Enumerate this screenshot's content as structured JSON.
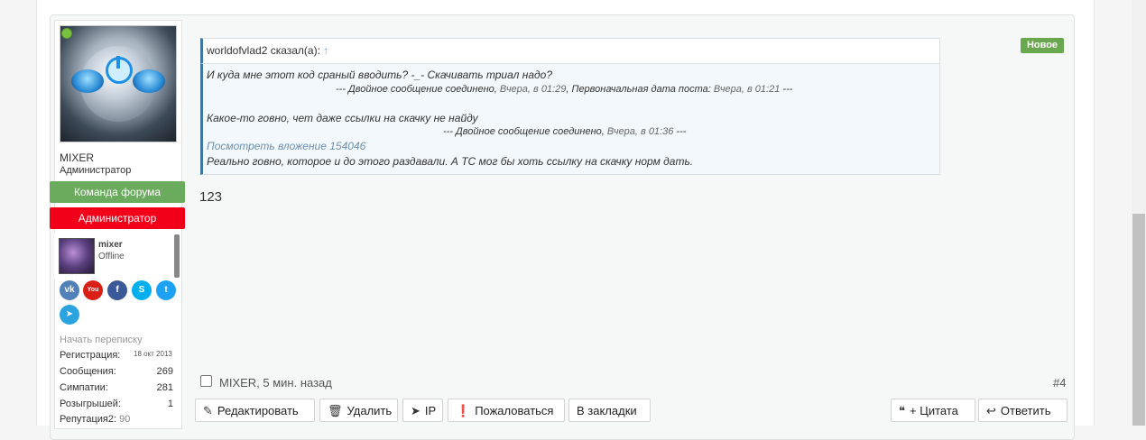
{
  "user": {
    "name": "MIXER",
    "title": "Администратор",
    "badge_team": "Команда форума",
    "badge_admin": "Администратор",
    "mini_name": "mixer",
    "mini_status": "Offline",
    "start_conversation": "Начать переписку",
    "stats": [
      {
        "label": "Регистрация:",
        "value": "18 окт 2013"
      },
      {
        "label": "Сообщения:",
        "value": "269"
      },
      {
        "label": "Симпатии:",
        "value": "281"
      },
      {
        "label": "Розыгрышей:",
        "value": "1"
      },
      {
        "label": "Репутация2:",
        "value": "90"
      }
    ],
    "social": {
      "vk": "vk",
      "youtube": "You Tube",
      "facebook": "f",
      "skype": "S",
      "twitter": "t",
      "telegram": "➤"
    }
  },
  "quote": {
    "author": "worldofvlad2 сказал(а):",
    "arrow": "↑",
    "line1": "И куда мне этот код сраный вводить? -_- Скачивать триал надо?",
    "merge1_prefix": "--- Двойное сообщение соединено,",
    "merge1_time": "Вчера, в 01:29",
    "merge1_mid": ", Первоначальная дата поста:",
    "merge1_orig": "Вчера, в 01:21",
    "merge1_suffix": "---",
    "line2": "Какое-то говно, чет даже ссылки на скачку не найду",
    "merge2_prefix": "--- Двойное сообщение соединено,",
    "merge2_time": "Вчера, в 01:36",
    "merge2_suffix": "---",
    "attachment": "Посмотреть вложение 154046",
    "line3": "Реально говно, которое и до этого раздавали. А ТС мог бы хоть ссылку на скачку норм дать."
  },
  "post": {
    "new_badge": "Новое",
    "body": "123",
    "meta": "MIXER, 5 мин. назад",
    "number": "#4"
  },
  "actions": {
    "edit": "Редактировать",
    "delete": "Удалить",
    "ip": "IP",
    "report": "Пожаловаться",
    "bookmark": "В закладки",
    "quote": "+ Цитата",
    "reply": "Ответить"
  },
  "colors": {
    "badge_team": "#6aab5d",
    "badge_admin": "#f2001a",
    "new_badge": "#6aa84f",
    "quote_border": "#3e77a3"
  }
}
